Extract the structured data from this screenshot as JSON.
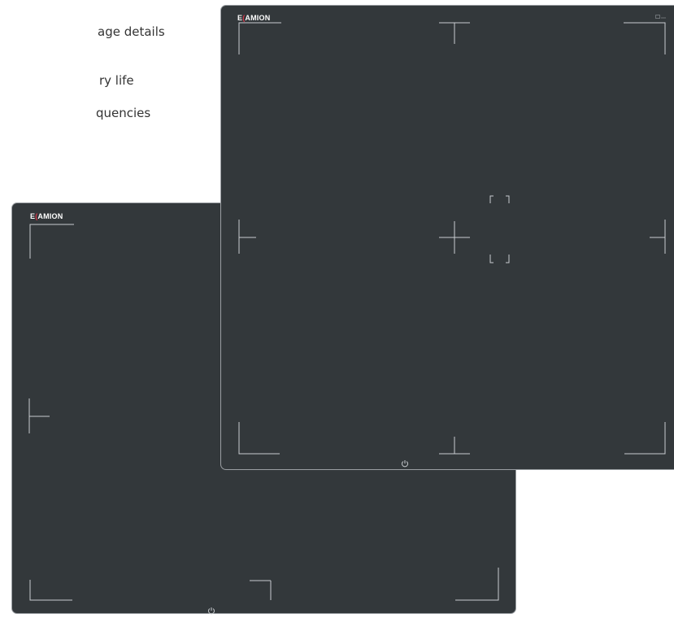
{
  "feature_text": {
    "line1": "age details",
    "line2": "ry life",
    "line3": "quencies"
  },
  "back_panel": {
    "logo_prefix": "E",
    "logo_mark": "(",
    "logo_suffix": "AMION",
    "power_icon": "power-icon"
  },
  "front_panel": {
    "logo_prefix": "E",
    "logo_mark": "(",
    "logo_suffix": "AMION",
    "power_icon": "power-icon",
    "indicator_icon": "status-indicator-icon"
  },
  "colors": {
    "panel": "#33383b",
    "guide_lines": "#c9cdd0",
    "brand_accent": "#d9374a",
    "panel_border": "#9b9fa3"
  }
}
